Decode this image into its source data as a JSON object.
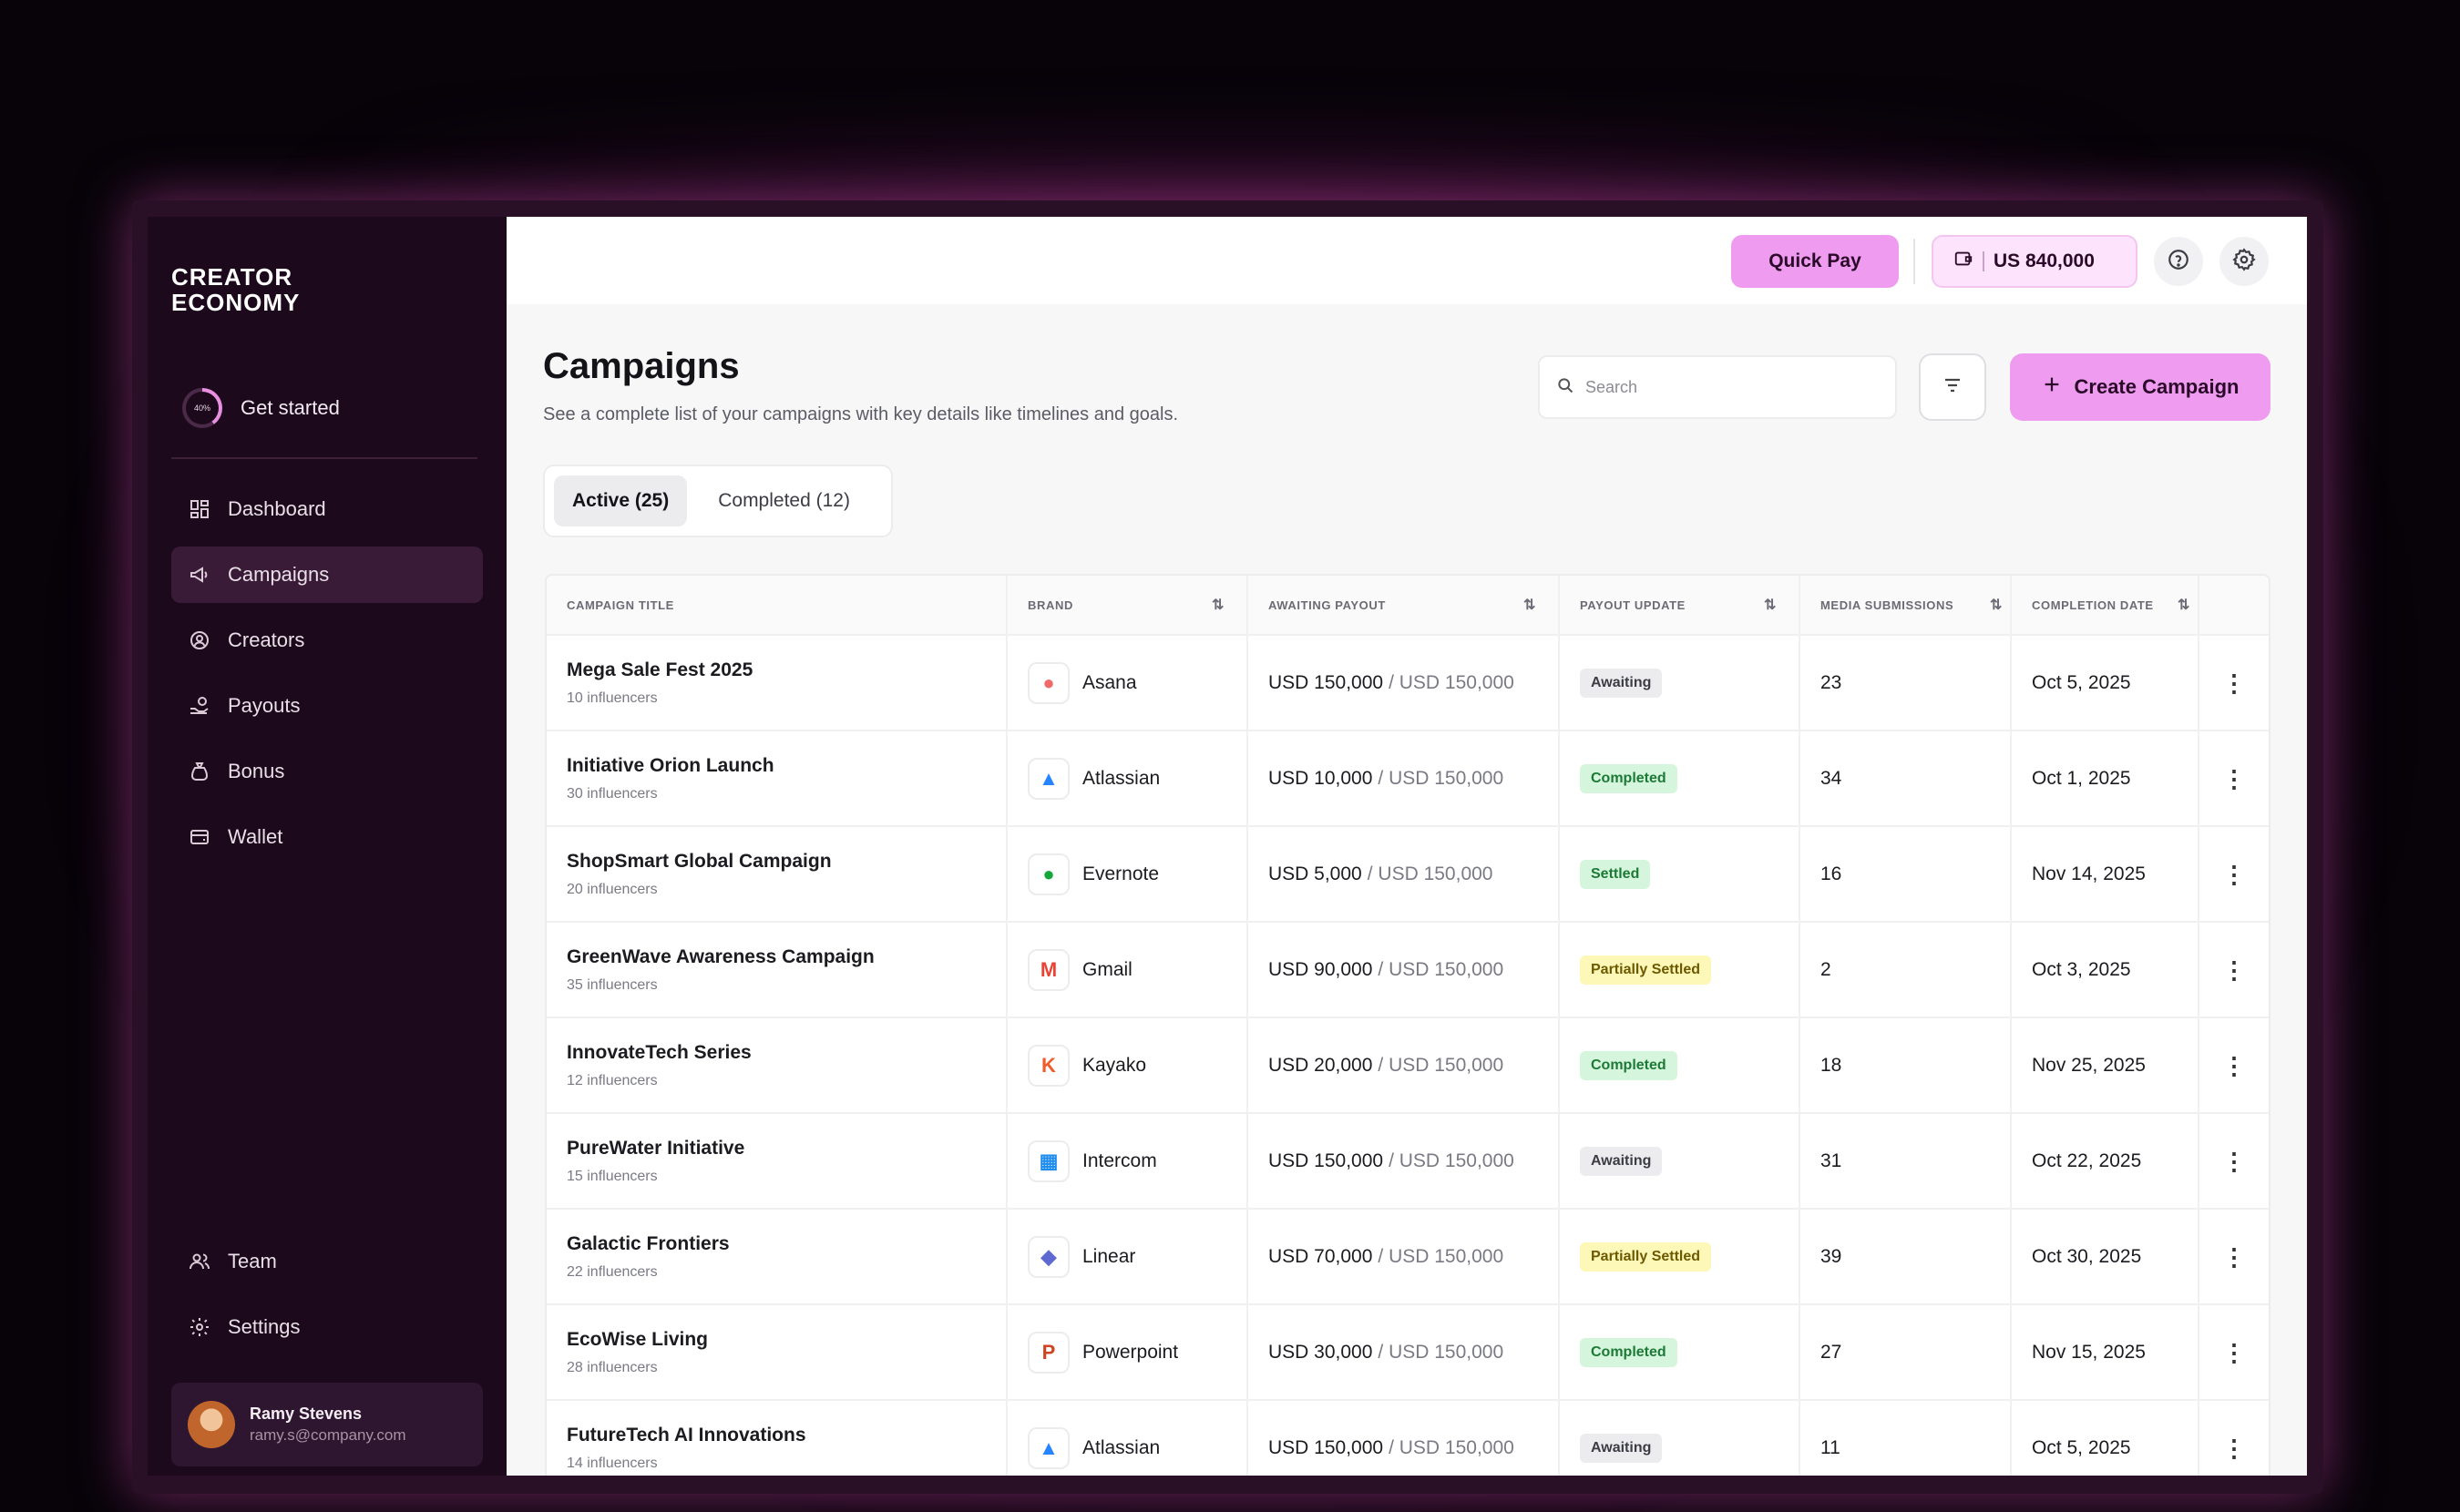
{
  "app": {
    "logo_text": "CREATOR\nECONOMY"
  },
  "sidebar": {
    "get_started": {
      "label": "Get started",
      "progress_label": "40%",
      "progress": 0.4
    },
    "items": [
      {
        "label": "Dashboard",
        "icon": "dashboard-icon"
      },
      {
        "label": "Campaigns",
        "icon": "megaphone-icon",
        "active": true
      },
      {
        "label": "Creators",
        "icon": "creators-icon"
      },
      {
        "label": "Payouts",
        "icon": "payouts-icon"
      },
      {
        "label": "Bonus",
        "icon": "bonus-bag-icon"
      },
      {
        "label": "Wallet",
        "icon": "wallet-icon"
      }
    ],
    "bottom_items": [
      {
        "label": "Team",
        "icon": "team-icon"
      },
      {
        "label": "Settings",
        "icon": "settings-icon"
      }
    ],
    "user": {
      "name": "Ramy Stevens",
      "email": "ramy.s@company.com"
    }
  },
  "topbar": {
    "quick_pay_label": "Quick Pay",
    "balance_label": "US 840,000",
    "help_icon": "help-icon",
    "settings_icon": "gear-icon"
  },
  "page": {
    "title": "Campaigns",
    "subtitle": "See a complete list of your campaigns with key details like timelines and goals.",
    "search_placeholder": "Search",
    "create_label": "Create Campaign",
    "tabs": [
      {
        "label": "Active (25)",
        "active": true
      },
      {
        "label": "Completed (12)",
        "active": false
      }
    ]
  },
  "table": {
    "columns": [
      "Campaign Title",
      "Brand",
      "Awaiting Payout",
      "Payout Update",
      "Media Submissions",
      "Completion Date"
    ],
    "rows": [
      {
        "title": "Mega Sale Fest 2025",
        "influencers": "10 influencers",
        "brand": "Asana",
        "awaiting": "USD 150,000",
        "total": "/ USD 150,000",
        "status": "Awaiting",
        "media": "23",
        "date": "Oct 5, 2025"
      },
      {
        "title": "Initiative Orion Launch",
        "influencers": "30 influencers",
        "brand": "Atlassian",
        "awaiting": "USD 10,000",
        "total": "/ USD 150,000",
        "status": "Completed",
        "media": "34",
        "date": "Oct 1, 2025"
      },
      {
        "title": "ShopSmart Global Campaign",
        "influencers": "20 influencers",
        "brand": "Evernote",
        "awaiting": "USD 5,000",
        "total": "/ USD 150,000",
        "status": "Settled",
        "media": "16",
        "date": "Nov 14, 2025"
      },
      {
        "title": "GreenWave Awareness Campaign",
        "influencers": "35 influencers",
        "brand": "Gmail",
        "awaiting": "USD 90,000",
        "total": "/ USD 150,000",
        "status": "Partially Settled",
        "media": "2",
        "date": "Oct 3, 2025"
      },
      {
        "title": "InnovateTech Series",
        "influencers": "12 influencers",
        "brand": "Kayako",
        "awaiting": "USD 20,000",
        "total": "/ USD 150,000",
        "status": "Completed",
        "media": "18",
        "date": "Nov 25, 2025"
      },
      {
        "title": "PureWater Initiative",
        "influencers": "15 influencers",
        "brand": "Intercom",
        "awaiting": "USD 150,000",
        "total": "/ USD 150,000",
        "status": "Awaiting",
        "media": "31",
        "date": "Oct 22, 2025"
      },
      {
        "title": "Galactic Frontiers",
        "influencers": "22 influencers",
        "brand": "Linear",
        "awaiting": "USD 70,000",
        "total": "/ USD 150,000",
        "status": "Partially Settled",
        "media": "39",
        "date": "Oct 30, 2025"
      },
      {
        "title": "EcoWise Living",
        "influencers": "28 influencers",
        "brand": "Powerpoint",
        "awaiting": "USD 30,000",
        "total": "/ USD 150,000",
        "status": "Completed",
        "media": "27",
        "date": "Nov 15, 2025"
      },
      {
        "title": "FutureTech AI Innovations",
        "influencers": "14 influencers",
        "brand": "Atlassian",
        "awaiting": "USD 150,000",
        "total": "/ USD 150,000",
        "status": "Awaiting",
        "media": "11",
        "date": "Oct 5, 2025"
      }
    ]
  },
  "colors": {
    "accent": "#ef9bf0",
    "sidebar_bg": "#1c0a1c",
    "status_awaiting_bg": "#ececef",
    "status_completed_bg": "#d6f5dd",
    "status_settled_bg": "#d6f5dd",
    "status_partial_bg": "#fdf7b8"
  }
}
